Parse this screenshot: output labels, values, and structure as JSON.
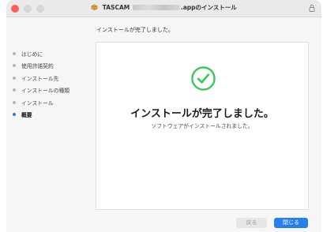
{
  "window": {
    "title_prefix": "TASCAM",
    "title_suffix": ".appのインストール"
  },
  "subtitle": "インストールが完了しました。",
  "sidebar": {
    "items": [
      {
        "label": "はじめに"
      },
      {
        "label": "使用許諾契約"
      },
      {
        "label": "インストール先"
      },
      {
        "label": "インストールの種類"
      },
      {
        "label": "インストール"
      },
      {
        "label": "概要"
      }
    ],
    "active_index": 5
  },
  "main": {
    "headline": "インストールが完了しました。",
    "message": "ソフトウェアがインストールされました。"
  },
  "buttons": {
    "back": "戻る",
    "close": "閉じる"
  },
  "colors": {
    "accent": "#2680eb",
    "success": "#34c759",
    "close_light": "#ff5f57"
  },
  "icons": {
    "package": "package-icon",
    "lock": "lock-icon",
    "success": "check-circle-icon"
  }
}
